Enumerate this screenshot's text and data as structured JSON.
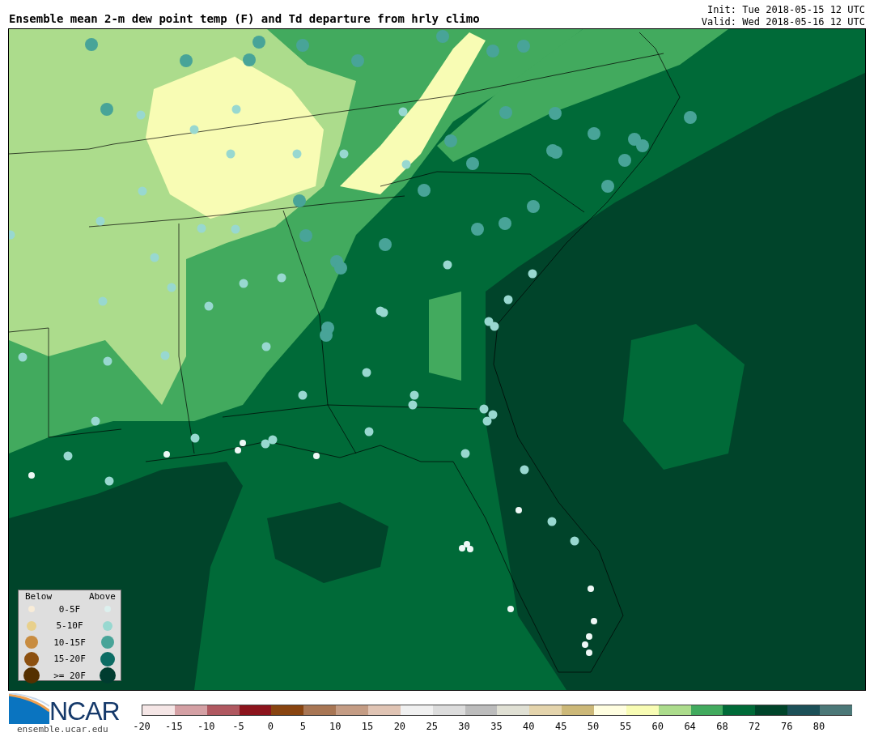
{
  "header": {
    "title": "Ensemble mean 2-m dew point temp (F) and Td departure from hrly climo",
    "init": "Init: Tue 2018-05-15 12 UTC",
    "valid": "Valid: Wed 2018-05-16 12 UTC"
  },
  "legend": {
    "below_label": "Below",
    "above_label": "Above",
    "items": [
      {
        "label": "0-5F",
        "below": {
          "color": "#f8ecd8"
        },
        "above": {
          "color": "#dcf0ee"
        }
      },
      {
        "label": "5-10F",
        "below": {
          "color": "#e8d08c"
        },
        "above": {
          "color": "#98d8d0"
        }
      },
      {
        "label": "10-15F",
        "below": {
          "color": "#c88c40"
        },
        "above": {
          "color": "#48a498"
        }
      },
      {
        "label": "15-20F",
        "below": {
          "color": "#8c5010"
        },
        "above": {
          "color": "#0c6c64"
        }
      },
      {
        "label": ">= 20F",
        "below": {
          "color": "#543000"
        },
        "above": {
          "color": "#003c30"
        }
      }
    ]
  },
  "logo": {
    "name": "NCAR",
    "url": "ensemble.ucar.edu"
  },
  "colorbar": {
    "segments": [
      {
        "color": "#f5e6e6"
      },
      {
        "color": "#d4a0a4"
      },
      {
        "color": "#b05860"
      },
      {
        "color": "#8c141c"
      },
      {
        "color": "#884410"
      },
      {
        "color": "#a87654"
      },
      {
        "color": "#c49c84"
      },
      {
        "color": "#e0c4b4"
      },
      {
        "color": "#f0f0f0"
      },
      {
        "color": "#dcdcdc"
      },
      {
        "color": "#bcbcbc"
      },
      {
        "color": "#e0e0d4"
      },
      {
        "color": "#e4d4ac"
      },
      {
        "color": "#ccb878"
      },
      {
        "color": "#fffee0"
      },
      {
        "color": "#f8fcb4"
      },
      {
        "color": "#acdc8c"
      },
      {
        "color": "#42aa5e"
      },
      {
        "color": "#006a38"
      },
      {
        "color": "#00442a"
      },
      {
        "color": "#1c5058"
      },
      {
        "color": "#4c7878"
      }
    ],
    "ticks": [
      "-20",
      "-15",
      "-10",
      "-5",
      "0",
      "5",
      "10",
      "15",
      "20",
      "25",
      "30",
      "35",
      "40",
      "45",
      "50",
      "55",
      "60",
      "64",
      "68",
      "72",
      "76",
      "80"
    ]
  }
}
